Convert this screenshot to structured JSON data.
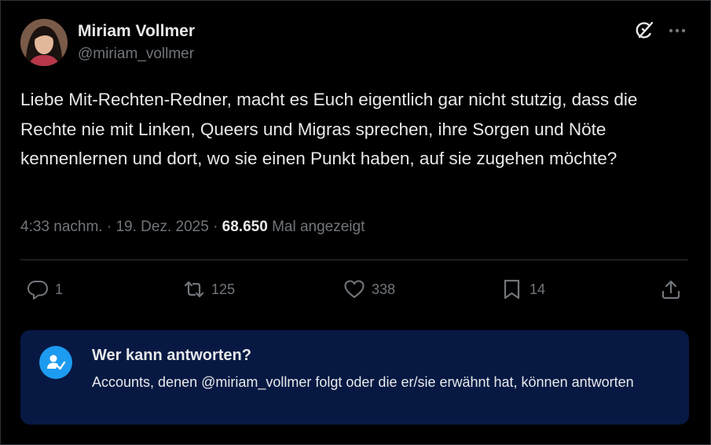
{
  "author": {
    "name": "Miriam Vollmer",
    "handle": "@miriam_vollmer",
    "avatar_icon": "profile-photo"
  },
  "tweet": {
    "text": "Liebe Mit-Rechten-Redner, macht es Euch eigentlich gar nicht stutzig, dass die Rechte nie mit Linken, Queers und Migras sprechen, ihre Sorgen und Nöte kennenlernen und dort, wo sie einen Punkt haben, auf sie zugehen möchte?",
    "time": "4:33 nachm.",
    "date": "19. Dez. 2025",
    "separator": "·",
    "views_count": "68.650",
    "views_label": "Mal angezeigt"
  },
  "actions": {
    "replies": "1",
    "reposts": "125",
    "likes": "338",
    "bookmarks": "14"
  },
  "reply_info": {
    "title": "Wer kann antworten?",
    "body": "Accounts, denen @miriam_vollmer folgt oder die er/sie erwähnt hat, können antworten"
  },
  "colors": {
    "background": "#000000",
    "text": "#e7e9ea",
    "muted": "#71767b",
    "card_background": "#071943",
    "accent": "#1d9bf0"
  }
}
